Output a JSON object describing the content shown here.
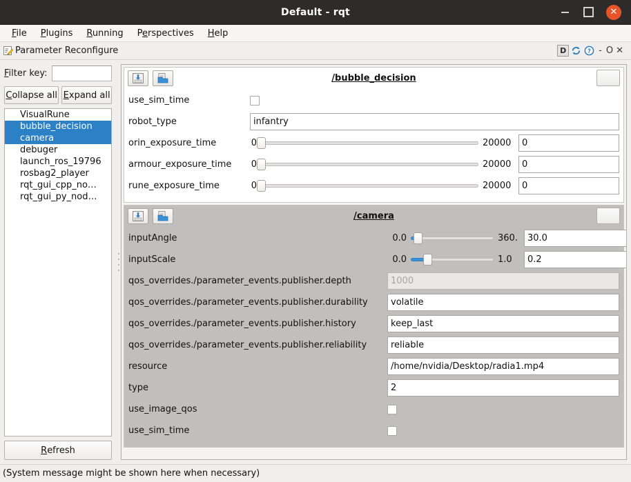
{
  "window": {
    "title": "Default - rqt",
    "controls": {
      "minimize": "—",
      "maximize": "□",
      "close": "✕"
    }
  },
  "menubar": {
    "items": [
      {
        "label": "File",
        "mnemonic": "F"
      },
      {
        "label": "Plugins",
        "mnemonic": "P"
      },
      {
        "label": "Running",
        "mnemonic": "R"
      },
      {
        "label": "Perspectives",
        "mnemonic": "e"
      },
      {
        "label": "Help",
        "mnemonic": "H"
      }
    ]
  },
  "plugin_bar": {
    "title": "Parameter Reconfigure",
    "icon": "pencil-icon",
    "right_controls": {
      "dock_label": "D",
      "reload_icon": "reload-icon",
      "help_icon": "help-icon",
      "dash": "-",
      "minimize": "O",
      "close": "✕"
    }
  },
  "sidebar": {
    "filter": {
      "label": "Filter key:",
      "mnemonic": "F",
      "value": "",
      "placeholder": ""
    },
    "buttons": [
      {
        "label": "Collapse all",
        "mnemonic": "C"
      },
      {
        "label": "Expand all",
        "mnemonic": "E"
      }
    ],
    "nodes": [
      {
        "label": "VisualRune",
        "selected": false
      },
      {
        "label": "bubble_decision",
        "selected": true
      },
      {
        "label": "camera",
        "selected": true
      },
      {
        "label": "debuger",
        "selected": false
      },
      {
        "label": "launch_ros_19796",
        "selected": false
      },
      {
        "label": "rosbag2_player",
        "selected": false
      },
      {
        "label": "rqt_gui_cpp_no…",
        "selected": false
      },
      {
        "label": "rqt_gui_py_nod…",
        "selected": false
      }
    ],
    "refresh": {
      "label": "Refresh",
      "mnemonic": "R"
    }
  },
  "groups": [
    {
      "title": "/bubble_decision",
      "theme": "white",
      "toolbar": {
        "save_icon": "save-icon",
        "load_icon": "load-icon",
        "extra_button": ""
      },
      "params": [
        {
          "name": "use_sim_time",
          "kind": "checkbox",
          "checked": false
        },
        {
          "name": "robot_type",
          "kind": "text",
          "value": "infantry"
        },
        {
          "name": "orin_exposure_time",
          "kind": "slider",
          "min": "0",
          "max": "20000",
          "value": "0",
          "percent": 0
        },
        {
          "name": "armour_exposure_time",
          "kind": "slider",
          "min": "0",
          "max": "20000",
          "value": "0",
          "percent": 0
        },
        {
          "name": "rune_exposure_time",
          "kind": "slider",
          "min": "0",
          "max": "20000",
          "value": "0",
          "percent": 0
        }
      ]
    },
    {
      "title": "/camera",
      "theme": "grey",
      "toolbar": {
        "save_icon": "save-icon",
        "load_icon": "load-icon",
        "extra_button": ""
      },
      "params": [
        {
          "name": "inputAngle",
          "kind": "slider_cam",
          "min": "0.0",
          "max": "360.",
          "value": "30.0",
          "percent": 8
        },
        {
          "name": "inputScale",
          "kind": "slider_cam",
          "min": "0.0",
          "max": "1.0",
          "value": "0.2",
          "percent": 20
        },
        {
          "name": "qos_overrides./parameter_events.publisher.depth",
          "kind": "text_disabled",
          "value": "1000"
        },
        {
          "name": "qos_overrides./parameter_events.publisher.durability",
          "kind": "text",
          "value": "volatile"
        },
        {
          "name": "qos_overrides./parameter_events.publisher.history",
          "kind": "text",
          "value": "keep_last"
        },
        {
          "name": "qos_overrides./parameter_events.publisher.reliability",
          "kind": "text",
          "value": "reliable"
        },
        {
          "name": "resource",
          "kind": "text",
          "value": "/home/nvidia/Desktop/radia1.mp4"
        },
        {
          "name": "type",
          "kind": "text",
          "value": "2"
        },
        {
          "name": "use_image_qos",
          "kind": "checkbox",
          "checked": false
        },
        {
          "name": "use_sim_time",
          "kind": "checkbox",
          "checked": false
        }
      ]
    }
  ],
  "statusbar": {
    "message": "(System message might be shown here when necessary)"
  },
  "colors": {
    "titlebar_bg": "#2e2c2b",
    "close_button": "#e8532a",
    "selection": "#2b80c6",
    "slider_fill": "#3a90d8",
    "panel_grey": "#c0bfbd",
    "panel_white": "#ffffff"
  }
}
